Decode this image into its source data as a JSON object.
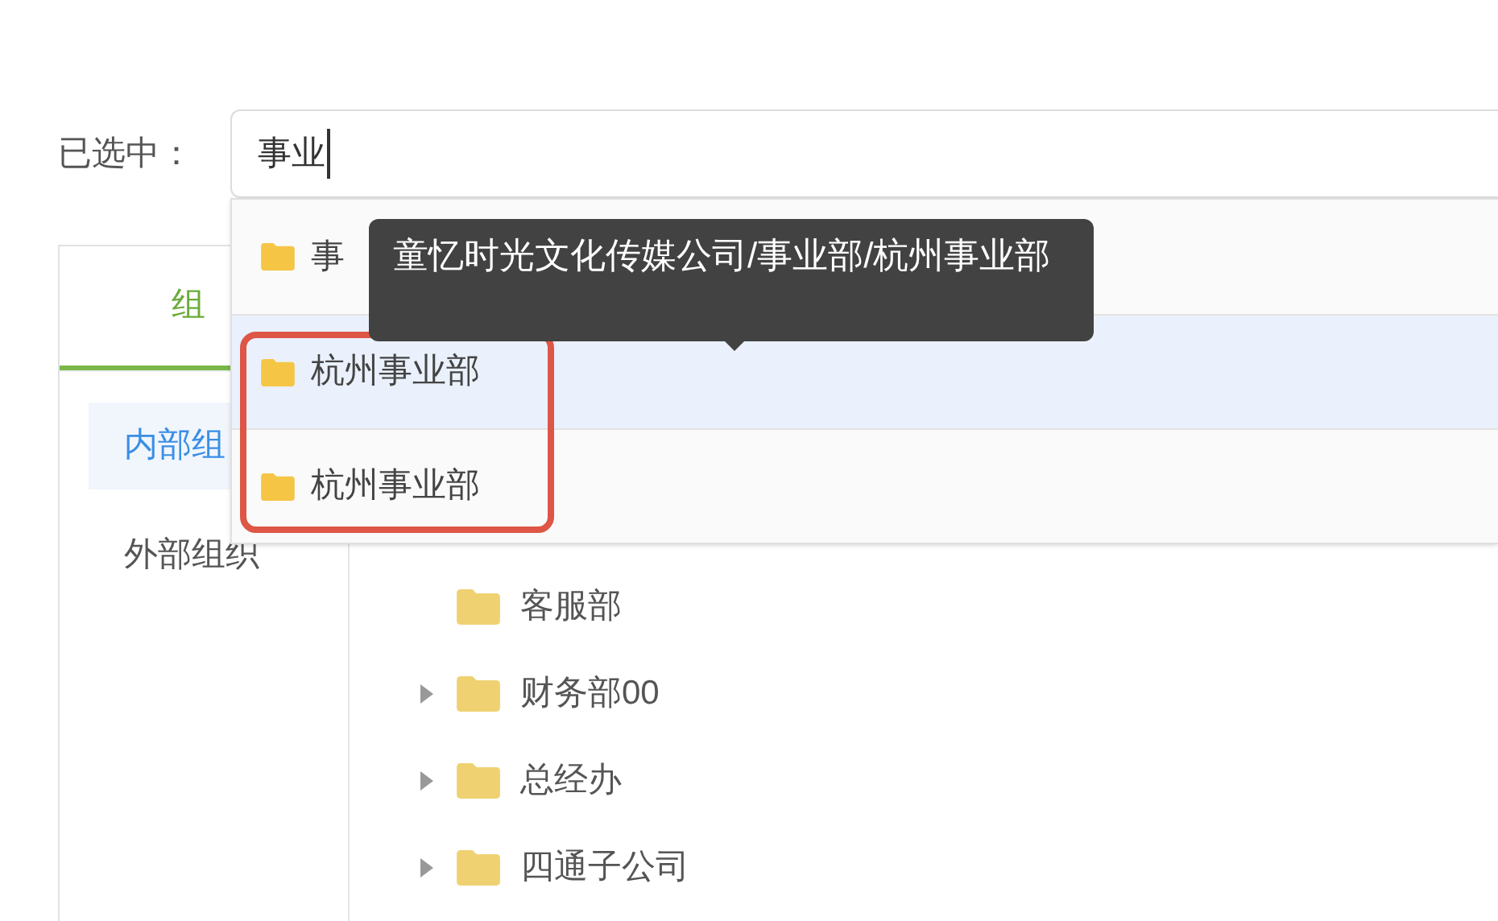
{
  "selection": {
    "label": "已选中：",
    "value": "事业"
  },
  "panel": {
    "tabs": [
      {
        "label": "组",
        "selected": true
      }
    ],
    "sidebar": [
      {
        "label": "内部组",
        "selected": true
      },
      {
        "label": "外部组织",
        "selected": false
      }
    ],
    "tree": [
      {
        "label": "客服部",
        "expandable": false
      },
      {
        "label": "财务部00",
        "expandable": true
      },
      {
        "label": "总经办",
        "expandable": true
      },
      {
        "label": "四通子公司",
        "expandable": true
      }
    ]
  },
  "dropdown": [
    {
      "label": "事",
      "selected": false
    },
    {
      "label": "杭州事业部",
      "selected": true
    },
    {
      "label": "杭州事业部",
      "selected": false
    }
  ],
  "tooltip": "童忆时光文化传媒公司/事业部/杭州事业部"
}
